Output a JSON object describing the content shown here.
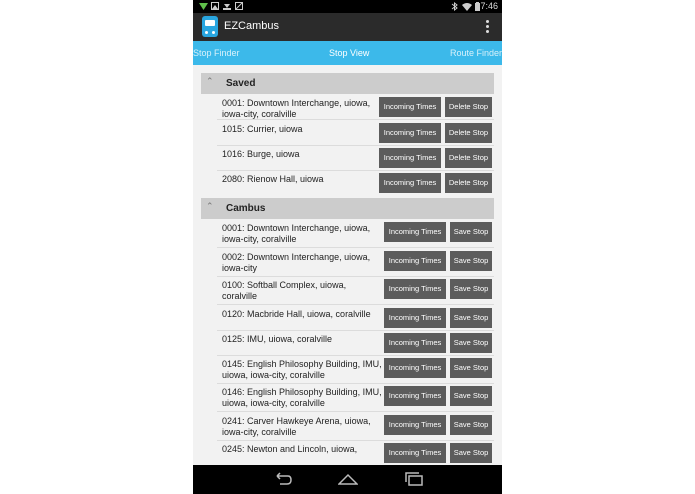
{
  "status_bar": {
    "time": "7:46"
  },
  "app": {
    "title": "EZCambus"
  },
  "tabs": [
    {
      "label": "Stop Finder"
    },
    {
      "label": "Stop View"
    },
    {
      "label": "Route Finder"
    }
  ],
  "saved": {
    "title": "Saved",
    "incoming_label": "Incoming Times",
    "action_label": "Delete Stop",
    "rows": [
      {
        "label": "0001: Downtown Interchange, uiowa, iowa-city, coralville"
      },
      {
        "label": "1015: Currier, uiowa"
      },
      {
        "label": "1016: Burge, uiowa"
      },
      {
        "label": "2080: Rienow Hall, uiowa"
      }
    ]
  },
  "cambus": {
    "title": "Cambus",
    "incoming_label": "Incoming Times",
    "action_label": "Save Stop",
    "rows": [
      {
        "label": "0001: Downtown Interchange, uiowa, iowa-city, coralville"
      },
      {
        "label": "0002: Downtown Interchange, uiowa, iowa-city"
      },
      {
        "label": "0100: Softball Complex, uiowa, coralville"
      },
      {
        "label": "0120: Macbride Hall, uiowa, coralville"
      },
      {
        "label": "0125: IMU, uiowa, coralville"
      },
      {
        "label": "0145: English Philosophy Building, IMU, uiowa, iowa-city, coralville"
      },
      {
        "label": "0146: English Philosophy Building, IMU, uiowa, iowa-city, coralville"
      },
      {
        "label": "0241: Carver Hawkeye Arena, uiowa, iowa-city, coralville"
      },
      {
        "label": "0245: Newton and Lincoln, uiowa,"
      }
    ]
  }
}
